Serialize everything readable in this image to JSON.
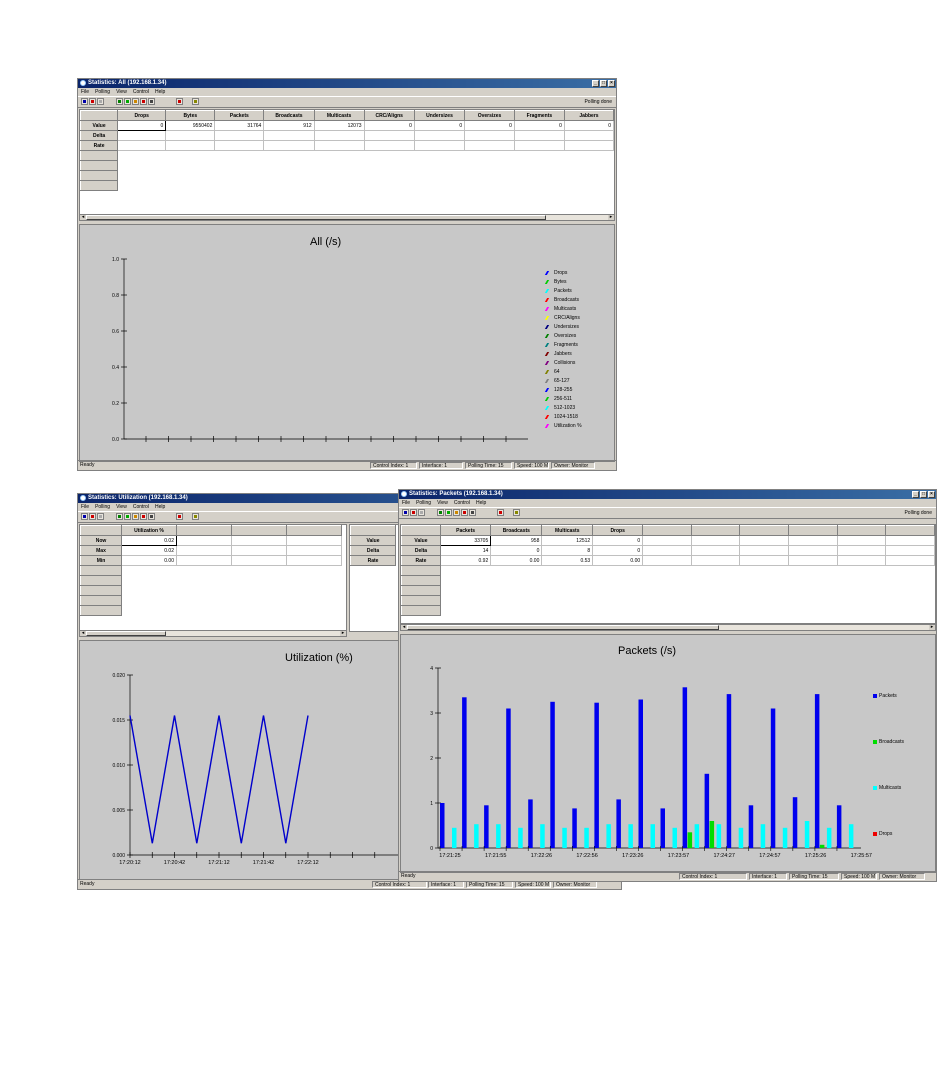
{
  "menu": [
    "File",
    "Polling",
    "View",
    "Control",
    "Help"
  ],
  "status_ready": "Ready",
  "status_cells": {
    "control_index": "Control Index: 1",
    "interface": "Interface: 1",
    "polling_time": "Polling Time: 15",
    "speed": "Speed: 100 M",
    "owner": "Owner: Monitor"
  },
  "polling_done": "Polling done",
  "window_all": {
    "title": "Statistics: All (192.168.1.34)",
    "columns": [
      "Drops",
      "Bytes",
      "Packets",
      "Broadcasts",
      "Multicasts",
      "CRC/Aligns",
      "Undersizes",
      "Oversizes",
      "Fragments",
      "Jabbers"
    ],
    "rows": [
      {
        "label": "Value",
        "cells": [
          "0",
          "9550402",
          "31764",
          "912",
          "12073",
          "0",
          "0",
          "0",
          "0",
          "0"
        ]
      },
      {
        "label": "Delta",
        "cells": [
          "",
          "",
          "",
          "",
          "",
          "",
          "",
          "",
          "",
          ""
        ]
      },
      {
        "label": "Rate",
        "cells": [
          "",
          "",
          "",
          "",
          "",
          "",
          "",
          "",
          "",
          ""
        ]
      }
    ],
    "chart_title": "All (/s)",
    "legend": [
      {
        "label": "Drops",
        "color": "#0000ff"
      },
      {
        "label": "Bytes",
        "color": "#00cc00"
      },
      {
        "label": "Packets",
        "color": "#00ffff"
      },
      {
        "label": "Broadcasts",
        "color": "#ff0000"
      },
      {
        "label": "Multicasts",
        "color": "#ff00ff"
      },
      {
        "label": "CRC/Aligns",
        "color": "#ffff00"
      },
      {
        "label": "Undersizes",
        "color": "#000080"
      },
      {
        "label": "Oversizes",
        "color": "#008000"
      },
      {
        "label": "Fragments",
        "color": "#008080"
      },
      {
        "label": "Jabbers",
        "color": "#800000"
      },
      {
        "label": "Collisions",
        "color": "#800080"
      },
      {
        "label": "64",
        "color": "#808000"
      },
      {
        "label": "65-127",
        "color": "#808080"
      },
      {
        "label": "128-255",
        "color": "#0000ff"
      },
      {
        "label": "256-511",
        "color": "#00cc00"
      },
      {
        "label": "512-1023",
        "color": "#00ffff"
      },
      {
        "label": "1024-1518",
        "color": "#ff0000"
      },
      {
        "label": "Utilization %",
        "color": "#ff00ff"
      }
    ]
  },
  "window_util": {
    "title": "Statistics: Utilization (192.168.1.34)",
    "column": "Utilization %",
    "rows": [
      {
        "label": "Now",
        "value": "0.02"
      },
      {
        "label": "Max",
        "value": "0.02"
      },
      {
        "label": "Min",
        "value": "0.00"
      }
    ],
    "partial_rows": [
      "Value",
      "Delta",
      "Rate"
    ],
    "chart_title": "Utilization (%)"
  },
  "window_packets": {
    "title": "Statistics: Packets (192.168.1.34)",
    "columns": [
      "Packets",
      "Broadcasts",
      "Multicasts",
      "Drops"
    ],
    "rows": [
      {
        "label": "Value",
        "cells": [
          "33705",
          "958",
          "12512",
          "0"
        ]
      },
      {
        "label": "Delta",
        "cells": [
          "14",
          "0",
          "8",
          "0"
        ]
      },
      {
        "label": "Rate",
        "cells": [
          "0.92",
          "0.00",
          "0.53",
          "0.00"
        ]
      }
    ],
    "chart_title": "Packets (/s)"
  },
  "chart_data": [
    {
      "type": "line",
      "title": "All (/s)",
      "ylim": [
        0,
        1.0
      ],
      "yticks": [
        "0.0",
        "0.2",
        "0.4",
        "0.6",
        "0.8",
        "1.0"
      ],
      "legend_position": "right",
      "series": []
    },
    {
      "type": "line",
      "title": "Utilization (%)",
      "ylim": [
        0,
        0.02
      ],
      "yticks": [
        "0.000",
        "0.005",
        "0.010",
        "0.015",
        "0.020"
      ],
      "xticks": [
        "17:20:12",
        "17:20:42",
        "17:21:12",
        "17:21:42",
        "17:22:12"
      ],
      "color": "#0000cc",
      "series": [
        {
          "values": [
            0.0155,
            0.0013,
            0.0155,
            0.0013,
            0.0155,
            0.0013,
            0.0155,
            0.0013,
            0.0155
          ]
        }
      ]
    },
    {
      "type": "bar",
      "title": "Packets (/s)",
      "ylim": [
        0,
        4
      ],
      "yticks": [
        "0",
        "1",
        "2",
        "3",
        "4"
      ],
      "xticks": [
        "17:21:25",
        "17:21:55",
        "17:22:26",
        "17:22:56",
        "17:23:26",
        "17:23:57",
        "17:24:27",
        "17:24:57",
        "17:25:26",
        "17:25:57"
      ],
      "legend_position": "right",
      "series": [
        {
          "name": "Packets",
          "color": "#0000ee",
          "values": [
            1.0,
            3.35,
            0.95,
            3.1,
            1.08,
            3.25,
            0.88,
            3.23,
            1.08,
            3.3,
            0.88,
            3.57,
            1.65,
            3.42,
            0.95,
            3.1,
            1.13,
            3.42,
            0.95
          ]
        },
        {
          "name": "Broadcasts",
          "color": "#00dd00",
          "values": [
            0,
            0,
            0,
            0,
            0,
            0,
            0,
            0,
            0,
            0,
            0,
            0.35,
            0.6,
            0,
            0,
            0,
            0,
            0.07,
            0
          ]
        },
        {
          "name": "Multicasts",
          "color": "#00ffff",
          "values": [
            0.45,
            0.53,
            0.53,
            0.45,
            0.53,
            0.45,
            0.45,
            0.53,
            0.53,
            0.53,
            0.45,
            0.53,
            0.53,
            0.45,
            0.53,
            0.45,
            0.6,
            0.45,
            0.53
          ]
        },
        {
          "name": "Drops",
          "color": "#ee0000",
          "values": [
            0,
            0,
            0,
            0,
            0,
            0,
            0,
            0,
            0,
            0,
            0,
            0,
            0,
            0,
            0,
            0,
            0,
            0,
            0
          ]
        }
      ]
    }
  ]
}
